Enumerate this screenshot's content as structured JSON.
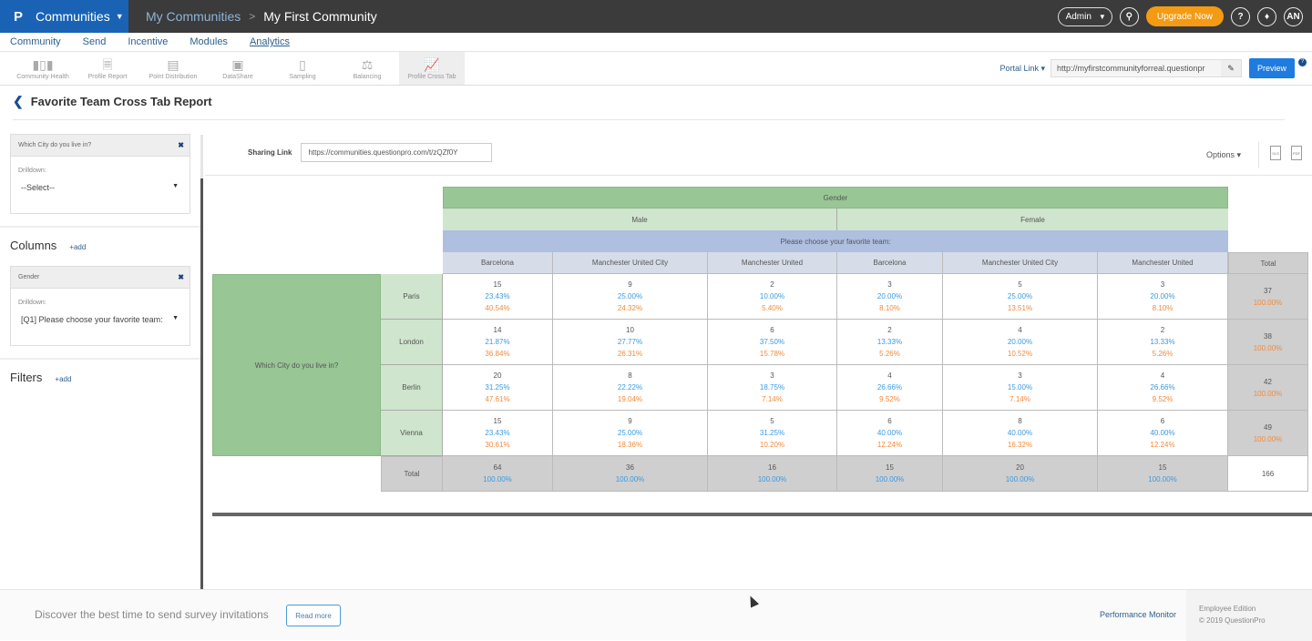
{
  "topbar": {
    "logo": "P",
    "app_name": "Communities",
    "breadcrumb": [
      "My Communities",
      "My First Community"
    ],
    "admin_label": "Admin",
    "upgrade_label": "Upgrade Now",
    "help_label": "?",
    "avatar_initials": "AN"
  },
  "main_nav": [
    "Community",
    "Send",
    "Incentive",
    "Modules",
    "Analytics"
  ],
  "main_nav_active": "Analytics",
  "tools": [
    {
      "label": "Community Health",
      "icon": "bar-chart-icon"
    },
    {
      "label": "Profile Report",
      "icon": "profile-report-icon"
    },
    {
      "label": "Point Distribution",
      "icon": "point-distribution-icon"
    },
    {
      "label": "DataShare",
      "icon": "datashare-icon"
    },
    {
      "label": "Sampling",
      "icon": "sampling-icon"
    },
    {
      "label": "Balancing",
      "icon": "balancing-icon"
    },
    {
      "label": "Profile Cross Tab",
      "icon": "cross-tab-icon",
      "active": true
    }
  ],
  "portal": {
    "label": "Portal Link",
    "url": "http://myfirstcommunityforreal.questionpr",
    "preview_label": "Preview"
  },
  "page": {
    "title": "Favorite Team Cross Tab Report"
  },
  "sidebar": {
    "rows_card": {
      "title": "Which City do you live in?",
      "drilldown_label": "Drilldown:",
      "drilldown_value": "--Select--"
    },
    "columns": {
      "heading": "Columns",
      "add_label": "+add"
    },
    "columns_card": {
      "title": "Gender",
      "drilldown_label": "Drilldown:",
      "drilldown_value": "[Q1] Please choose your favorite team:"
    },
    "filters": {
      "heading": "Filters",
      "add_label": "+add"
    }
  },
  "share": {
    "label": "Sharing Link",
    "url": "https://communities.questionpro.com/t/zQZf0Y",
    "options_label": "Options",
    "xls_label": "XLS",
    "pdf_label": "PDF"
  },
  "crosstab": {
    "col_group": "Gender",
    "col_subgroups": [
      "Male",
      "Female"
    ],
    "col_question": "Please choose your favorite team:",
    "col_headers": [
      "Barcelona",
      "Manchester United City",
      "Manchester United",
      "Barcelona",
      "Manchester United City",
      "Manchester United"
    ],
    "total_label": "Total",
    "row_question": "Which City do you live in?",
    "rows": [
      {
        "label": "Paris",
        "cells": [
          [
            "15",
            "23.43%",
            "40.54%"
          ],
          [
            "9",
            "25.00%",
            "24.32%"
          ],
          [
            "2",
            "10.00%",
            "5.40%"
          ],
          [
            "3",
            "20.00%",
            "8.10%"
          ],
          [
            "5",
            "25.00%",
            "13.51%"
          ],
          [
            "3",
            "20.00%",
            "8.10%"
          ]
        ],
        "total": [
          "37",
          "100.00%"
        ]
      },
      {
        "label": "London",
        "cells": [
          [
            "14",
            "21.87%",
            "36.84%"
          ],
          [
            "10",
            "27.77%",
            "26.31%"
          ],
          [
            "6",
            "37.50%",
            "15.78%"
          ],
          [
            "2",
            "13.33%",
            "5.26%"
          ],
          [
            "4",
            "20.00%",
            "10.52%"
          ],
          [
            "2",
            "13.33%",
            "5.26%"
          ]
        ],
        "total": [
          "38",
          "100.00%"
        ]
      },
      {
        "label": "Berlin",
        "cells": [
          [
            "20",
            "31.25%",
            "47.61%"
          ],
          [
            "8",
            "22.22%",
            "19.04%"
          ],
          [
            "3",
            "18.75%",
            "7.14%"
          ],
          [
            "4",
            "26.66%",
            "9.52%"
          ],
          [
            "3",
            "15.00%",
            "7.14%"
          ],
          [
            "4",
            "26.66%",
            "9.52%"
          ]
        ],
        "total": [
          "42",
          "100.00%"
        ]
      },
      {
        "label": "Vienna",
        "cells": [
          [
            "15",
            "23.43%",
            "30.61%"
          ],
          [
            "9",
            "25.00%",
            "18.36%"
          ],
          [
            "5",
            "31.25%",
            "10.20%"
          ],
          [
            "6",
            "40.00%",
            "12.24%"
          ],
          [
            "8",
            "40.00%",
            "16.32%"
          ],
          [
            "6",
            "40.00%",
            "12.24%"
          ]
        ],
        "total": [
          "49",
          "100.00%"
        ]
      }
    ],
    "totals": [
      [
        "64",
        "100.00%"
      ],
      [
        "36",
        "100.00%"
      ],
      [
        "16",
        "100.00%"
      ],
      [
        "15",
        "100.00%"
      ],
      [
        "20",
        "100.00%"
      ],
      [
        "15",
        "100.00%"
      ]
    ],
    "grand_total": "166"
  },
  "colors": {
    "brand_blue": "#1a63b4",
    "topbar": "#3b3b3b",
    "upgrade": "#f49b13",
    "header_green": "#98c695",
    "subheader_green": "#cfe5cd",
    "question_blue": "#aebfe0",
    "colheader_blue": "#d6dde9",
    "total_gray": "#cfcfcf",
    "pct_blue": "#3a9ae0",
    "pct_orange": "#f08a3c"
  },
  "footer": {
    "message": "Discover the best time to send survey invitations",
    "read_more": "Read more",
    "performance_monitor": "Performance Monitor",
    "edition": "Employee Edition",
    "copyright": "© 2019 QuestionPro"
  }
}
